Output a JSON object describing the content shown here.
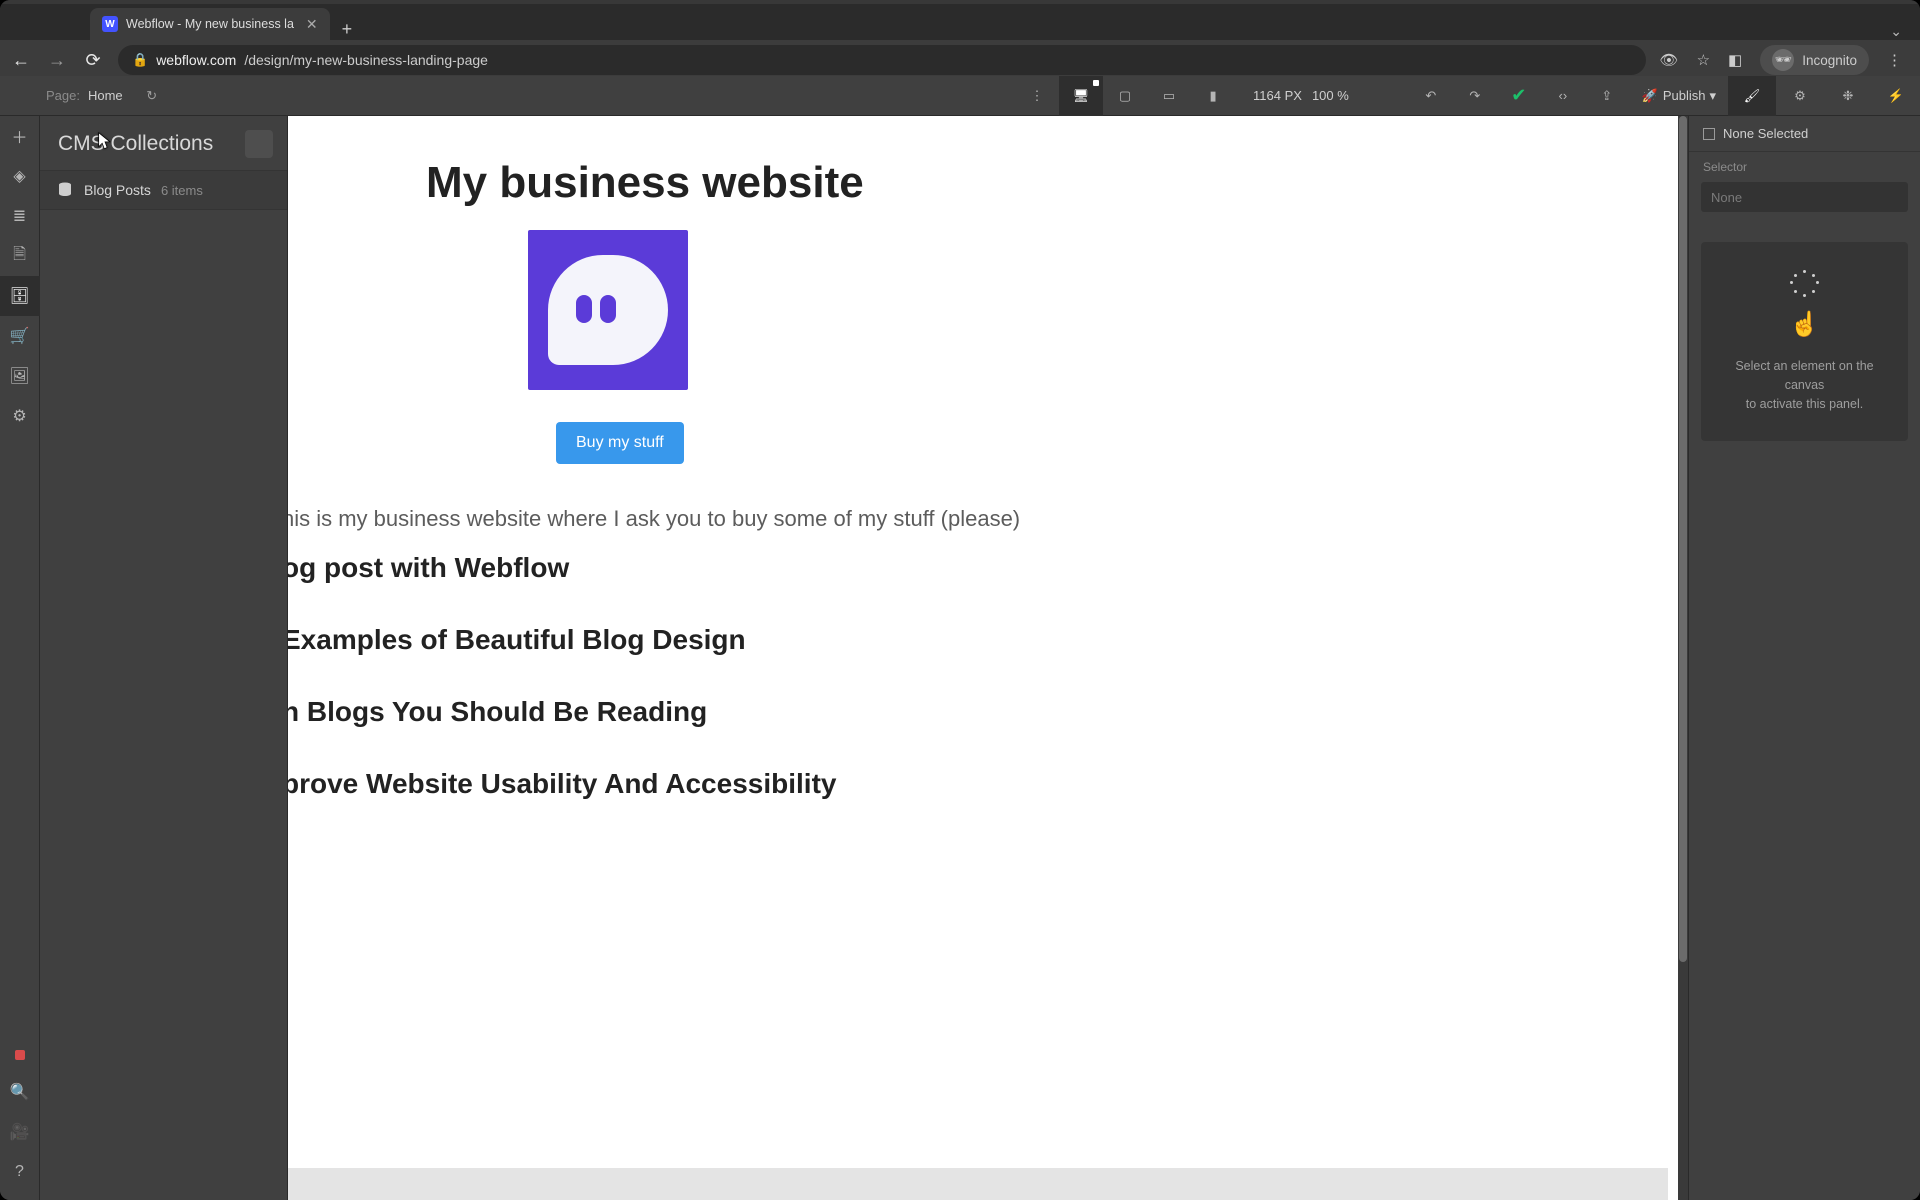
{
  "browser": {
    "tab_title": "Webflow - My new business la",
    "url_host": "webflow.com",
    "url_path": "/design/my-new-business-landing-page",
    "incognito_label": "Incognito"
  },
  "topbar": {
    "page_label": "Page:",
    "page_name": "Home",
    "canvas_px": "1164 PX",
    "zoom": "100 %",
    "publish_label": "Publish"
  },
  "left_panel": {
    "title": "CMS Collections",
    "collection_name": "Blog Posts",
    "collection_count": "6 items"
  },
  "canvas": {
    "heading": "My business website",
    "cta": "Buy my stuff",
    "body": "his is my business website where I ask you to buy some of my stuff (please)",
    "posts": [
      "og post with Webflow",
      "Examples of Beautiful Blog Design",
      "n Blogs You Should Be Reading",
      "prove Website Usability And Accessibility"
    ]
  },
  "right_panel": {
    "none_selected": "None Selected",
    "selector_label": "Selector",
    "selector_value": "None",
    "empty_line1": "Select an element on the canvas",
    "empty_line2": "to activate this panel."
  }
}
